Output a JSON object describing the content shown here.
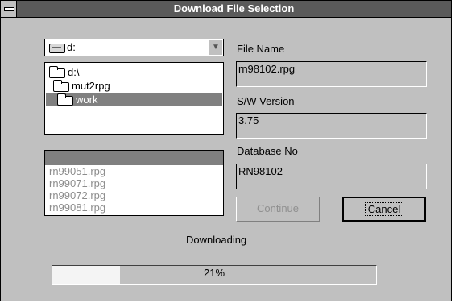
{
  "window": {
    "title": "Download File Selection"
  },
  "drive": {
    "value": "d:"
  },
  "directories": [
    {
      "label": "d:\\",
      "selected": false
    },
    {
      "label": "mut2rpg",
      "selected": false
    },
    {
      "label": "work",
      "selected": true
    }
  ],
  "files": [
    "rn99051.rpg",
    "rn99071.rpg",
    "rn99072.rpg",
    "rn99081.rpg"
  ],
  "fields": {
    "file_name": {
      "label": "File Name",
      "value": "rn98102.rpg"
    },
    "sw_version": {
      "label": "S/W Version",
      "value": "3.75"
    },
    "database_no": {
      "label": "Database No",
      "value": "RN98102"
    }
  },
  "buttons": {
    "continue": "Continue",
    "cancel": "Cancel"
  },
  "download": {
    "label": "Downloading",
    "progress_text": "21%",
    "progress": 0.21
  },
  "icons": {
    "system_menu": "system-menu-icon",
    "drive": "drive-icon",
    "folder": "folder-icon",
    "dropdown": "dropdown-arrow-icon"
  }
}
